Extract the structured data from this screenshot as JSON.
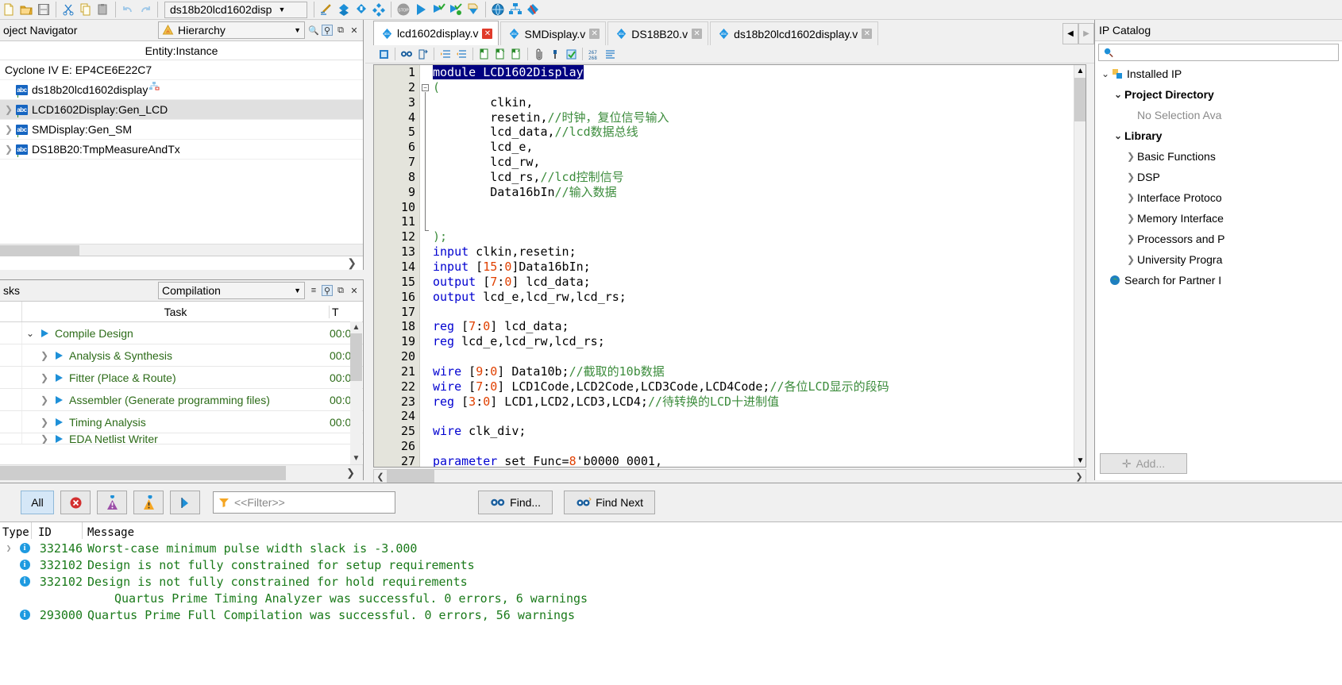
{
  "toolbar": {
    "project_name": "ds18b20lcd1602disp",
    "icons": [
      "new-file-icon",
      "open-folder-icon",
      "save-icon",
      "cut-icon",
      "copy-icon",
      "paste-icon",
      "undo-icon",
      "redo-icon"
    ],
    "icons2": [
      "settings-pencil-icon",
      "assignment-editor-icon",
      "pin-planner-icon",
      "compilation-blocks-icon",
      "stop-icon",
      "start-compilation-icon",
      "start-analysis-icon",
      "start-check-icon",
      "programmer-icon",
      "rtl-viewer-icon",
      "technology-map-icon",
      "chip-planner-icon"
    ]
  },
  "navigator": {
    "title": "oject Navigator",
    "view_mode": "Hierarchy",
    "column_header": "Entity:Instance",
    "device": "Cyclone IV E: EP4CE6E22C7",
    "top_entity": "ds18b20lcd1602display",
    "items": [
      {
        "label": "LCD1602Display:Gen_LCD",
        "selected": true
      },
      {
        "label": "SMDisplay:Gen_SM",
        "selected": false
      },
      {
        "label": "DS18B20:TmpMeasureAndTx",
        "selected": false
      }
    ]
  },
  "tasks": {
    "title": "sks",
    "flow": "Compilation",
    "columns": [
      "Task",
      "T"
    ],
    "rows": [
      {
        "label": "Compile Design",
        "time": "00:0",
        "indent": 0,
        "expanded": true
      },
      {
        "label": "Analysis & Synthesis",
        "time": "00:0",
        "indent": 1,
        "expanded": false
      },
      {
        "label": "Fitter (Place & Route)",
        "time": "00:0",
        "indent": 1,
        "expanded": false
      },
      {
        "label": "Assembler (Generate programming files)",
        "time": "00:0",
        "indent": 1,
        "expanded": false
      },
      {
        "label": "Timing Analysis",
        "time": "00:0",
        "indent": 1,
        "expanded": false
      },
      {
        "label": "EDA Netlist Writer",
        "time": "",
        "indent": 1,
        "expanded": false
      }
    ]
  },
  "editor": {
    "tabs": [
      {
        "label": "lcd1602display.v",
        "active": true,
        "close_red": true
      },
      {
        "label": "SMDisplay.v",
        "active": false,
        "close_red": false
      },
      {
        "label": "DS18B20.v",
        "active": false,
        "close_red": false
      },
      {
        "label": "ds18b20lcd1602display.v",
        "active": false,
        "close_red": false
      }
    ],
    "tools": [
      "bookmark-icon",
      "find-icon",
      "goto-line-icon",
      "indent-icon",
      "outdent-icon",
      "comment-icon",
      "uncomment-icon",
      "insert-template-icon",
      "paperclip-icon",
      "paint-icon",
      "check-syntax-icon",
      "line-numbers-icon",
      "wrap-text-icon"
    ],
    "line_count": 27,
    "lines": [
      {
        "n": 1,
        "tokens": [
          {
            "t": "module LCD1602Display",
            "c": "hl"
          }
        ]
      },
      {
        "n": 2,
        "tokens": [
          {
            "t": "(",
            "c": "cmt"
          }
        ]
      },
      {
        "n": 3,
        "tokens": [
          {
            "t": "        clkin,",
            "c": ""
          }
        ]
      },
      {
        "n": 4,
        "tokens": [
          {
            "t": "        resetin,",
            "c": ""
          },
          {
            "t": "//时钟，复位信号输入",
            "c": "cmt"
          }
        ]
      },
      {
        "n": 5,
        "tokens": [
          {
            "t": "        lcd_data,",
            "c": ""
          },
          {
            "t": "//lcd数据总线",
            "c": "cmt"
          }
        ]
      },
      {
        "n": 6,
        "tokens": [
          {
            "t": "        lcd_e,",
            "c": ""
          }
        ]
      },
      {
        "n": 7,
        "tokens": [
          {
            "t": "        lcd_rw,",
            "c": ""
          }
        ]
      },
      {
        "n": 8,
        "tokens": [
          {
            "t": "        lcd_rs,",
            "c": ""
          },
          {
            "t": "//lcd控制信号",
            "c": "cmt"
          }
        ]
      },
      {
        "n": 9,
        "tokens": [
          {
            "t": "        Data16bIn",
            "c": ""
          },
          {
            "t": "//输入数据",
            "c": "cmt"
          }
        ]
      },
      {
        "n": 10,
        "tokens": [
          {
            "t": "",
            "c": ""
          }
        ]
      },
      {
        "n": 11,
        "tokens": [
          {
            "t": "",
            "c": ""
          }
        ]
      },
      {
        "n": 12,
        "tokens": [
          {
            "t": ");",
            "c": "cmt"
          }
        ]
      },
      {
        "n": 13,
        "tokens": [
          {
            "t": "input",
            "c": "kw"
          },
          {
            "t": " clkin,resetin;",
            "c": ""
          }
        ]
      },
      {
        "n": 14,
        "tokens": [
          {
            "t": "input",
            "c": "kw"
          },
          {
            "t": " [",
            "c": ""
          },
          {
            "t": "15",
            "c": "num"
          },
          {
            "t": ":",
            "c": ""
          },
          {
            "t": "0",
            "c": "num"
          },
          {
            "t": "]Data16bIn;",
            "c": ""
          }
        ]
      },
      {
        "n": 15,
        "tokens": [
          {
            "t": "output",
            "c": "kw"
          },
          {
            "t": " [",
            "c": ""
          },
          {
            "t": "7",
            "c": "num"
          },
          {
            "t": ":",
            "c": ""
          },
          {
            "t": "0",
            "c": "num"
          },
          {
            "t": "] lcd_data;",
            "c": ""
          }
        ]
      },
      {
        "n": 16,
        "tokens": [
          {
            "t": "output",
            "c": "kw"
          },
          {
            "t": " lcd_e,lcd_rw,lcd_rs;",
            "c": ""
          }
        ]
      },
      {
        "n": 17,
        "tokens": [
          {
            "t": "",
            "c": ""
          }
        ]
      },
      {
        "n": 18,
        "tokens": [
          {
            "t": "reg",
            "c": "kw"
          },
          {
            "t": " [",
            "c": ""
          },
          {
            "t": "7",
            "c": "num"
          },
          {
            "t": ":",
            "c": ""
          },
          {
            "t": "0",
            "c": "num"
          },
          {
            "t": "] lcd_data;",
            "c": ""
          }
        ]
      },
      {
        "n": 19,
        "tokens": [
          {
            "t": "reg",
            "c": "kw"
          },
          {
            "t": " lcd_e,lcd_rw,lcd_rs;",
            "c": ""
          }
        ]
      },
      {
        "n": 20,
        "tokens": [
          {
            "t": "",
            "c": ""
          }
        ]
      },
      {
        "n": 21,
        "tokens": [
          {
            "t": "wire",
            "c": "kw"
          },
          {
            "t": " [",
            "c": ""
          },
          {
            "t": "9",
            "c": "num"
          },
          {
            "t": ":",
            "c": ""
          },
          {
            "t": "0",
            "c": "num"
          },
          {
            "t": "] Data10b;",
            "c": ""
          },
          {
            "t": "//截取的10b数据",
            "c": "cmt"
          }
        ]
      },
      {
        "n": 22,
        "tokens": [
          {
            "t": "wire",
            "c": "kw"
          },
          {
            "t": " [",
            "c": ""
          },
          {
            "t": "7",
            "c": "num"
          },
          {
            "t": ":",
            "c": ""
          },
          {
            "t": "0",
            "c": "num"
          },
          {
            "t": "] LCD1Code,LCD2Code,LCD3Code,LCD4Code;",
            "c": ""
          },
          {
            "t": "//各位LCD显示的段码",
            "c": "cmt"
          }
        ]
      },
      {
        "n": 23,
        "tokens": [
          {
            "t": "reg",
            "c": "kw"
          },
          {
            "t": " [",
            "c": ""
          },
          {
            "t": "3",
            "c": "num"
          },
          {
            "t": ":",
            "c": ""
          },
          {
            "t": "0",
            "c": "num"
          },
          {
            "t": "] LCD1,LCD2,LCD3,LCD4;",
            "c": ""
          },
          {
            "t": "//待转换的LCD十进制值",
            "c": "cmt"
          }
        ]
      },
      {
        "n": 24,
        "tokens": [
          {
            "t": "",
            "c": ""
          }
        ]
      },
      {
        "n": 25,
        "tokens": [
          {
            "t": "wire",
            "c": "kw"
          },
          {
            "t": " clk_div;",
            "c": ""
          }
        ]
      },
      {
        "n": 26,
        "tokens": [
          {
            "t": "",
            "c": ""
          }
        ]
      },
      {
        "n": 27,
        "tokens": [
          {
            "t": "parameter",
            "c": "kw"
          },
          {
            "t": " set_Func=",
            "c": ""
          },
          {
            "t": "8",
            "c": "num"
          },
          {
            "t": "'b0000_0001,",
            "c": ""
          }
        ]
      }
    ]
  },
  "ip_catalog": {
    "title": "IP Catalog",
    "search_placeholder": "",
    "rows": [
      {
        "label": "Installed IP",
        "indent": 0,
        "twisty": "down",
        "bold": false,
        "icon": "installed-ip-icon"
      },
      {
        "label": "Project Directory",
        "indent": 1,
        "twisty": "down",
        "bold": true,
        "icon": ""
      },
      {
        "label": "No Selection Ava",
        "indent": 2,
        "twisty": "none",
        "bold": false,
        "icon": "",
        "muted": true
      },
      {
        "label": "Library",
        "indent": 1,
        "twisty": "down",
        "bold": true,
        "icon": ""
      },
      {
        "label": "Basic Functions",
        "indent": 2,
        "twisty": "right",
        "bold": false,
        "icon": ""
      },
      {
        "label": "DSP",
        "indent": 2,
        "twisty": "right",
        "bold": false,
        "icon": ""
      },
      {
        "label": "Interface Protoco",
        "indent": 2,
        "twisty": "right",
        "bold": false,
        "icon": ""
      },
      {
        "label": "Memory Interface",
        "indent": 2,
        "twisty": "right",
        "bold": false,
        "icon": ""
      },
      {
        "label": "Processors and P",
        "indent": 2,
        "twisty": "right",
        "bold": false,
        "icon": ""
      },
      {
        "label": "University Progra",
        "indent": 2,
        "twisty": "right",
        "bold": false,
        "icon": ""
      },
      {
        "label": "Search for Partner I",
        "indent": 1,
        "twisty": "none",
        "bold": false,
        "icon": "globe-icon"
      }
    ],
    "add_button": "Add..."
  },
  "messages": {
    "filter_buttons": [
      "All",
      "error-icon",
      "critical-warning-icon",
      "warning-icon",
      "info-flag-icon"
    ],
    "all_label": "All",
    "filter_placeholder": "<<Filter>>",
    "find_label": "Find...",
    "find_next_label": "Find Next",
    "columns": [
      "Type",
      "ID",
      "Message"
    ],
    "rows": [
      {
        "expandable": true,
        "id": "332146",
        "text": "Worst-case minimum pulse width slack is -3.000"
      },
      {
        "expandable": false,
        "id": "332102",
        "text": "Design is not fully constrained for setup requirements"
      },
      {
        "expandable": false,
        "id": "332102",
        "text": "Design is not fully constrained for hold requirements"
      },
      {
        "expandable": false,
        "id": "",
        "text": "Quartus Prime Timing Analyzer was successful. 0 errors, 6 warnings"
      },
      {
        "expandable": false,
        "id": "293000",
        "text": "Quartus Prime Full Compilation was successful. 0 errors, 56 warnings"
      }
    ]
  },
  "colors": {
    "accent_blue": "#1e90d8",
    "keyword": "#0000d0",
    "number": "#e04000",
    "comment": "#3c8c3c",
    "selection": "#000080",
    "task_green": "#2c6b18",
    "message_green": "#1a7a1a"
  }
}
